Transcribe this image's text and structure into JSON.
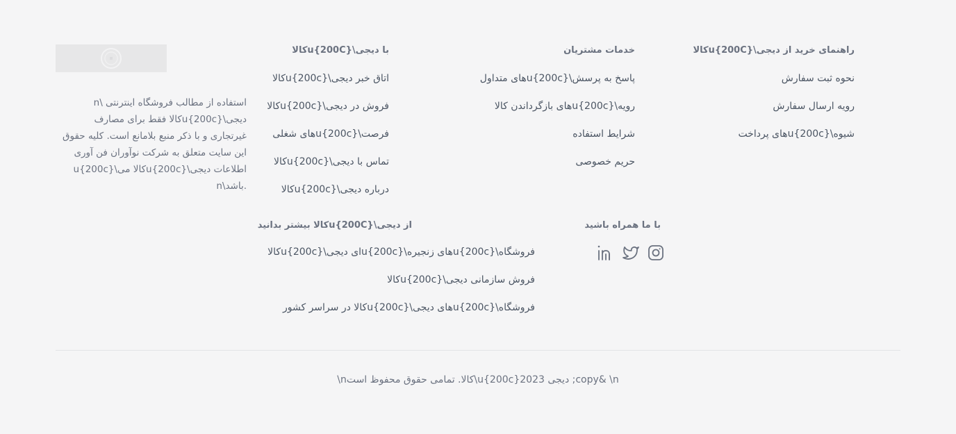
{
  "logo": {
    "alt": "لوگوی دیجی کالا"
  },
  "about_text": "استفاده از مطالب فروشگاه اینترنتی \\n\nدیجی\\u{200c}کالا فقط برای مصارف\nغیرتجاری و با ذکر منبع بلامانع است. کلیه حقوق\nاین سایت متعلق به شرکت نوآوران فن آوری\nاطلاعات دیجی\\u{200c}کالا می\\u{200c}\n.باشد\\n",
  "columns": {
    "guide": {
      "title": "راهنمای خرید از دیجی\\u{200C}کالا",
      "links": [
        "نحوه ثبت سفارش",
        "رویه ارسال سفارش",
        "شیوه\\u{200c}های پرداخت"
      ]
    },
    "service": {
      "title": "خدمات مشتریان",
      "links": [
        "پاسخ به پرسش\\u{200c}های متداول",
        "رویه\\u{200c}های بازگرداندن کالا",
        "شرایط استفاده",
        "حریم خصوصی"
      ]
    },
    "with": {
      "title": "با دیجی\\u{200C}کالا",
      "links": [
        "اتاق خبر دیجی\\u{200c}کالا",
        "فروش در دیجی\\u{200c}کالا",
        "فرصت\\u{200c}های شغلی",
        "تماس با دیجی\\u{200c}کالا",
        "درباره دیجی\\u{200c}کالا"
      ]
    },
    "social": {
      "title": "با ما همراه باشید",
      "icons": [
        "instagram-icon",
        "twitter-icon",
        "linkedin-icon"
      ]
    },
    "more": {
      "title": "از دیجی\\u{200C}کالا بیشتر بدانید",
      "links": [
        "فروشگاه\\u{200c}های زنجیره\\u{200c}ای دیجی\\u{200c}کالا",
        "فروش سازمانی دیجی\\u{200c}کالا",
        "فروشگاه\\u{200c}های دیجی\\u{200c}کالا در سراسر کشور"
      ]
    }
  },
  "copyright": "\\nکالا. تمامی حقوق محفوظ است\\u{200c}دیجی 2023 ;copy& \\n",
  "colors": {
    "background": "#f5f5f6",
    "text": "#4b5563",
    "muted": "#6b7280",
    "divider": "#e3e4e6"
  }
}
